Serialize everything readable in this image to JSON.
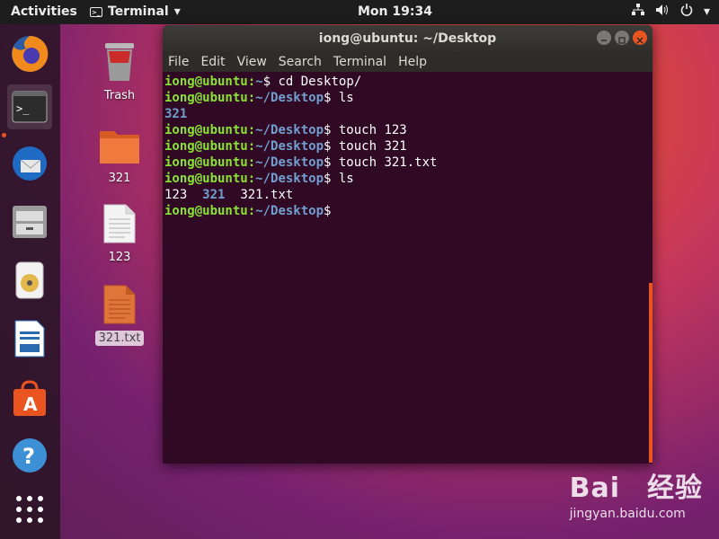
{
  "topbar": {
    "activities": "Activities",
    "app_name": "Terminal",
    "clock": "Mon 19:34"
  },
  "dock": {
    "items": [
      "firefox-icon",
      "terminal-icon",
      "thunderbird-icon",
      "files-icon",
      "rhythmbox-icon",
      "writer-icon",
      "software-icon",
      "help-icon",
      "apps-grid-icon"
    ]
  },
  "desktop": {
    "icons": [
      {
        "label": "Trash"
      },
      {
        "label": "321"
      },
      {
        "label": "123"
      },
      {
        "label": "321.txt"
      }
    ]
  },
  "terminal": {
    "title": "iong@ubuntu: ~/Desktop",
    "menu": [
      "File",
      "Edit",
      "View",
      "Search",
      "Terminal",
      "Help"
    ],
    "user": "iong@ubuntu",
    "lines": [
      {
        "path": "~",
        "cmd": " cd Desktop/"
      },
      {
        "path": "~/Desktop",
        "cmd": " ls"
      },
      {
        "out_dir": "321"
      },
      {
        "path": "~/Desktop",
        "cmd": " touch 123"
      },
      {
        "path": "~/Desktop",
        "cmd": " touch 321"
      },
      {
        "path": "~/Desktop",
        "cmd": " touch 321.txt"
      },
      {
        "path": "~/Desktop",
        "cmd": " ls"
      },
      {
        "out_mixed": [
          "123",
          "321",
          "321.txt"
        ]
      },
      {
        "path": "~/Desktop",
        "cmd": ""
      }
    ]
  },
  "watermark": {
    "brand": "Bai",
    "brand2": "经验",
    "url": "jingyan.baidu.com"
  },
  "colors": {
    "accent": "#e95420",
    "terminal_bg": "#300a24",
    "prompt_user": "#8ae234",
    "prompt_path": "#729fcf"
  }
}
